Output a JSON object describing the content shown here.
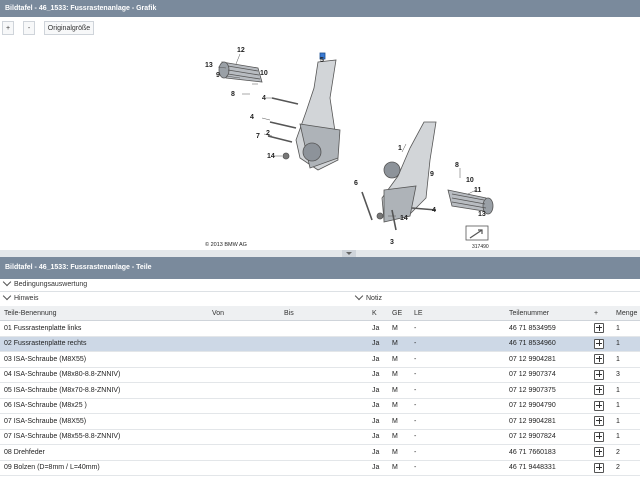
{
  "graphic_panel": {
    "title": "Bildtafel - 46_1533: Fussrastenanlage - Grafik",
    "zoom_in_label": "+",
    "zoom_out_label": "-",
    "original_size_label": "Originalgröße",
    "copyright": "© 2013 BMW AG",
    "image_number": "317490",
    "callouts": [
      "12",
      "13",
      "9",
      "8",
      "10",
      "4",
      "4",
      "2",
      "7",
      "14",
      "5",
      "1",
      "9",
      "8",
      "6",
      "10",
      "11",
      "13",
      "14",
      "3",
      "4"
    ]
  },
  "parts_panel": {
    "title": "Bildtafel - 46_1533: Fussrastenanlage - Teile",
    "condition_section": "Bedingungsauswertung",
    "hint_section": "Hinweis",
    "note_section": "Notiz",
    "columns": [
      "Teile-Benennung",
      "Von",
      "Bis",
      "K",
      "GE",
      "LE",
      "Teilenummer",
      "+",
      "Menge"
    ],
    "rows": [
      {
        "name": "01 Fussrastenplatte links",
        "von": "",
        "bis": "",
        "k": "Ja",
        "ge": "M",
        "le": "-",
        "nr": "46 71 8534959",
        "qty": "1",
        "selected": false
      },
      {
        "name": "02 Fussrastenplatte rechts",
        "von": "",
        "bis": "",
        "k": "Ja",
        "ge": "M",
        "le": "-",
        "nr": "46 71 8534960",
        "qty": "1",
        "selected": true
      },
      {
        "name": "03 ISA-Schraube (M8X55)",
        "von": "",
        "bis": "",
        "k": "Ja",
        "ge": "M",
        "le": "-",
        "nr": "07 12 9904281",
        "qty": "1",
        "selected": false
      },
      {
        "name": "04 ISA-Schraube (M8x80-8.8-ZNNIV)",
        "von": "",
        "bis": "",
        "k": "Ja",
        "ge": "M",
        "le": "-",
        "nr": "07 12 9907374",
        "qty": "3",
        "selected": false
      },
      {
        "name": "05 ISA-Schraube (M8x70-8.8-ZNNIV)",
        "von": "",
        "bis": "",
        "k": "Ja",
        "ge": "M",
        "le": "-",
        "nr": "07 12 9907375",
        "qty": "1",
        "selected": false
      },
      {
        "name": "06 ISA-Schraube (M8x25 )",
        "von": "",
        "bis": "",
        "k": "Ja",
        "ge": "M",
        "le": "-",
        "nr": "07 12 9904790",
        "qty": "1",
        "selected": false
      },
      {
        "name": "07 ISA-Schraube (M8X55)",
        "von": "",
        "bis": "",
        "k": "Ja",
        "ge": "M",
        "le": "-",
        "nr": "07 12 9904281",
        "qty": "1",
        "selected": false
      },
      {
        "name": "07 ISA-Schraube (M8x55-8.8-ZNNIV)",
        "von": "",
        "bis": "",
        "k": "Ja",
        "ge": "M",
        "le": "-",
        "nr": "07 12 9907824",
        "qty": "1",
        "selected": false
      },
      {
        "name": "08 Drehfeder",
        "von": "",
        "bis": "",
        "k": "Ja",
        "ge": "M",
        "le": "-",
        "nr": "46 71 7660183",
        "qty": "2",
        "selected": false
      },
      {
        "name": "09 Bolzen (D=8mm / L=40mm)",
        "von": "",
        "bis": "",
        "k": "Ja",
        "ge": "M",
        "le": "-",
        "nr": "46 71 9448331",
        "qty": "2",
        "selected": false
      }
    ]
  },
  "colors": {
    "titlebar": "#7a8a9c",
    "selected_row": "#cdd8e6"
  }
}
